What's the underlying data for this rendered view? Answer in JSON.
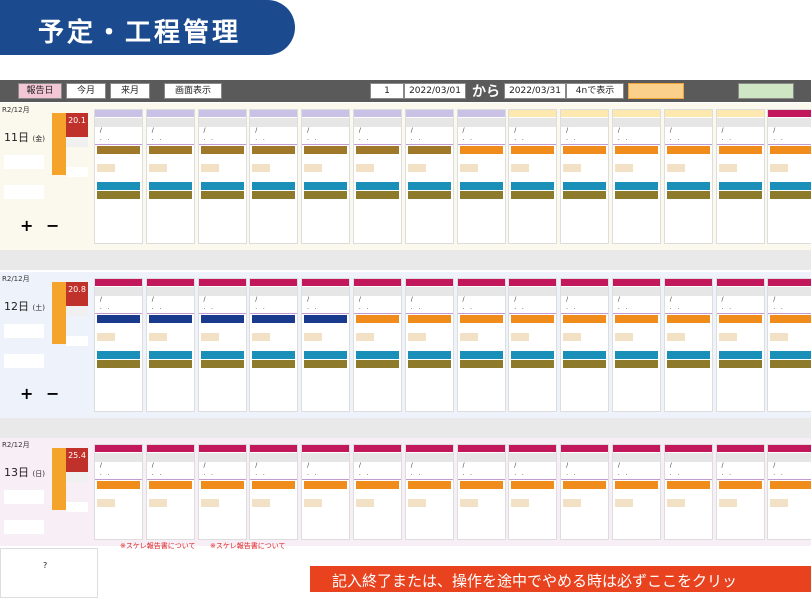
{
  "title": "予定・工程管理",
  "toolbar": {
    "b1": "報告日",
    "b2": "今月",
    "b3": "来月",
    "b4": "画面表示",
    "start": "2022/03/01",
    "from": "から",
    "end": "2022/03/31",
    "show": "4nで表示"
  },
  "days": [
    {
      "label": "R2/12月",
      "date": "11日",
      "dow": "(金)",
      "temp": "20.1"
    },
    {
      "label": "R2/12月",
      "date": "12日",
      "dow": "(土)",
      "temp": "20.8"
    },
    {
      "label": "R2/12月",
      "date": "13日",
      "dow": "(日)",
      "temp": "25.4"
    }
  ],
  "notes": {
    "n1": "※スケレ報告書について",
    "n2": "※スケレ報告書について",
    "warning": "記入終了または、操作を途中でやめる時は必ずここをクリッ",
    "q": "?"
  }
}
